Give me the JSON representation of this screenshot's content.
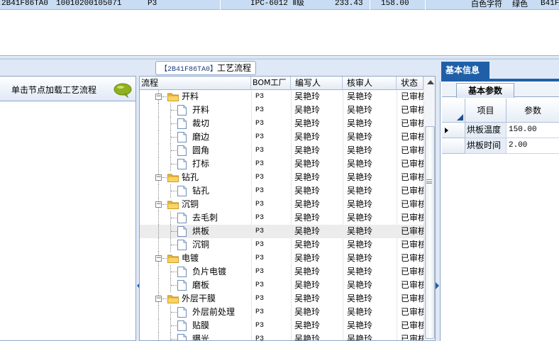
{
  "top_row": {
    "cells": [
      "2B41F86TA0",
      "10010200105071",
      "P3",
      "IPC-6012 Ⅱ级",
      "233.43",
      "158.00",
      "白色字符",
      "绿色",
      "B41F"
    ]
  },
  "left_panel": {
    "hint": "单击节点加载工艺流程"
  },
  "center_panel": {
    "title_id": "【2B41F86TA0】",
    "title_text": "工艺流程",
    "columns": [
      "流程",
      "BOM工厂",
      "编写人",
      "核审人",
      "状态"
    ],
    "rows": [
      {
        "name": "开料",
        "kind": "group",
        "factory": "P3",
        "writer": "吴艳玲",
        "reviewer": "吴艳玲",
        "status": "已审核"
      },
      {
        "name": "开料",
        "kind": "step",
        "factory": "P3",
        "writer": "吴艳玲",
        "reviewer": "吴艳玲",
        "status": "已审核"
      },
      {
        "name": "裁切",
        "kind": "step",
        "factory": "P3",
        "writer": "吴艳玲",
        "reviewer": "吴艳玲",
        "status": "已审核"
      },
      {
        "name": "磨边",
        "kind": "step",
        "factory": "P3",
        "writer": "吴艳玲",
        "reviewer": "吴艳玲",
        "status": "已审核"
      },
      {
        "name": "圆角",
        "kind": "step",
        "factory": "P3",
        "writer": "吴艳玲",
        "reviewer": "吴艳玲",
        "status": "已审核"
      },
      {
        "name": "打标",
        "kind": "step",
        "factory": "P3",
        "writer": "吴艳玲",
        "reviewer": "吴艳玲",
        "status": "已审核"
      },
      {
        "name": "钻孔",
        "kind": "group",
        "factory": "P3",
        "writer": "吴艳玲",
        "reviewer": "吴艳玲",
        "status": "已审核"
      },
      {
        "name": "钻孔",
        "kind": "step",
        "factory": "P3",
        "writer": "吴艳玲",
        "reviewer": "吴艳玲",
        "status": "已审核"
      },
      {
        "name": "沉铜",
        "kind": "group",
        "factory": "P3",
        "writer": "吴艳玲",
        "reviewer": "吴艳玲",
        "status": "已审核"
      },
      {
        "name": "去毛刺",
        "kind": "step",
        "factory": "P3",
        "writer": "吴艳玲",
        "reviewer": "吴艳玲",
        "status": "已审核"
      },
      {
        "name": "烘板",
        "kind": "step",
        "factory": "P3",
        "writer": "吴艳玲",
        "reviewer": "吴艳玲",
        "status": "已审核",
        "selected": true
      },
      {
        "name": "沉铜",
        "kind": "step",
        "factory": "P3",
        "writer": "吴艳玲",
        "reviewer": "吴艳玲",
        "status": "已审核"
      },
      {
        "name": "电镀",
        "kind": "group",
        "factory": "P3",
        "writer": "吴艳玲",
        "reviewer": "吴艳玲",
        "status": "已审核"
      },
      {
        "name": "负片电镀",
        "kind": "step",
        "factory": "P3",
        "writer": "吴艳玲",
        "reviewer": "吴艳玲",
        "status": "已审核"
      },
      {
        "name": "磨板",
        "kind": "step",
        "factory": "P3",
        "writer": "吴艳玲",
        "reviewer": "吴艳玲",
        "status": "已审核"
      },
      {
        "name": "外层干膜",
        "kind": "group",
        "factory": "P3",
        "writer": "吴艳玲",
        "reviewer": "吴艳玲",
        "status": "已审核"
      },
      {
        "name": "外层前处理",
        "kind": "step",
        "factory": "P3",
        "writer": "吴艳玲",
        "reviewer": "吴艳玲",
        "status": "已审核"
      },
      {
        "name": "贴膜",
        "kind": "step",
        "factory": "P3",
        "writer": "吴艳玲",
        "reviewer": "吴艳玲",
        "status": "已审核"
      },
      {
        "name": "曝光",
        "kind": "step",
        "factory": "P3",
        "writer": "吴艳玲",
        "reviewer": "吴艳玲",
        "status": "已审核"
      }
    ]
  },
  "right_panel": {
    "tab": "基本信息",
    "subtab": "基本参数",
    "columns": [
      "项目",
      "参数"
    ],
    "params": [
      {
        "name": "烘板温度",
        "value": "150.00",
        "current": true
      },
      {
        "name": "烘板时间",
        "value": "2.00"
      }
    ]
  },
  "colors": {
    "accent_blue": "#1f5fa8",
    "selected_row": "#c8dcf3",
    "panel_border": "#8ea6c8",
    "chat_icon": "#8fb020"
  }
}
